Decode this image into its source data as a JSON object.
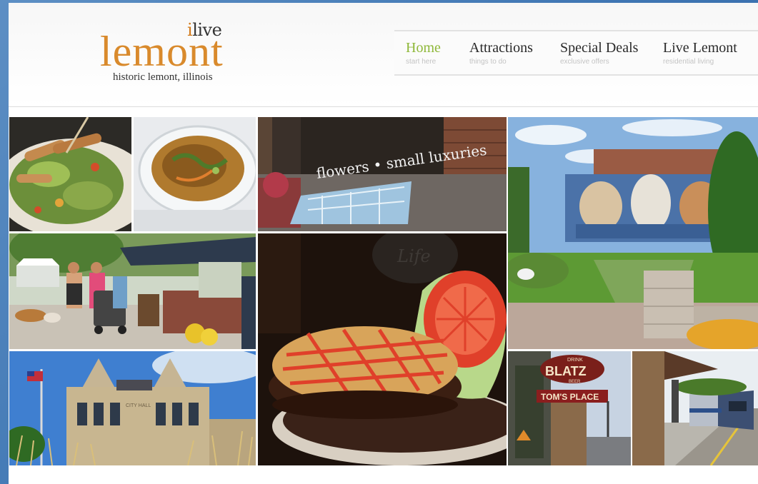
{
  "logo": {
    "ilive_i": "i",
    "ilive_rest": "live",
    "main": "lemont",
    "tagline": "historic lemont, illinois"
  },
  "nav": {
    "items": [
      {
        "label": "Home",
        "sub": "start here",
        "active": true
      },
      {
        "label": "Attractions",
        "sub": "things to do",
        "active": false
      },
      {
        "label": "Special Deals",
        "sub": "exclusive offers",
        "active": false
      },
      {
        "label": "Live Lemont",
        "sub": "residential living",
        "active": false
      }
    ]
  },
  "photos": {
    "storefront_sign": "flowers • small luxuries",
    "bottle_logo": "Life",
    "blatz_top": "DRINK",
    "blatz_main": "BLATZ",
    "blatz_sub": "BEER",
    "toms_place": "TOM'S PLACE",
    "city_hall": "CITY HALL"
  },
  "colors": {
    "brand_orange": "#d98a2c",
    "nav_active": "#8fb83a",
    "background_blue": "#3f76b3"
  }
}
